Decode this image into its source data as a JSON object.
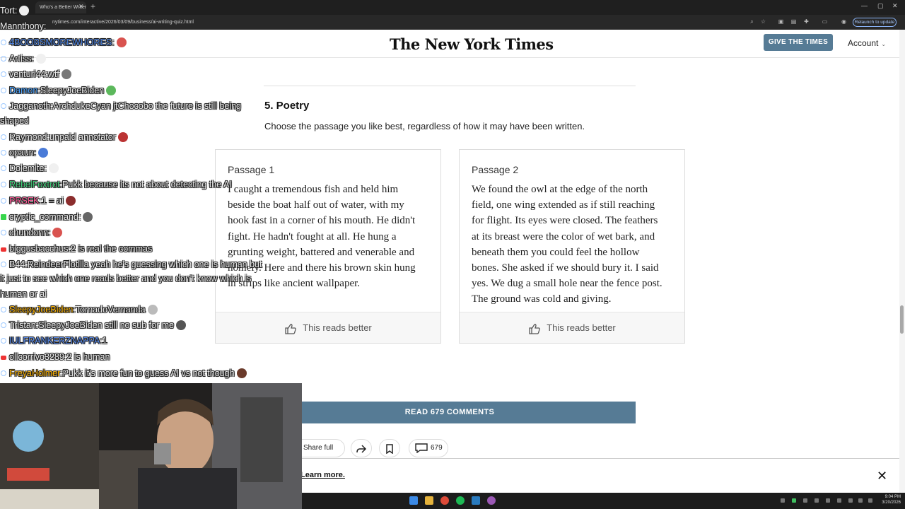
{
  "browser": {
    "tab_title": "Who's a Better Writer: A.I. or H",
    "url": "nytimes.com/interactive/2026/03/09/business/ai-writing-quiz.html",
    "update_label": "Relaunch to update"
  },
  "nyt": {
    "logo": "The New York Times",
    "give_button": "GIVE THE TIMES",
    "account": "Account"
  },
  "quiz": {
    "section_title": "5. Poetry",
    "instructions": "Choose the passage you like best, regardless of how it may have been written.",
    "passages": [
      {
        "label": "Passage 1",
        "text": "I caught a tremendous fish and held him beside the boat half out of water, with my hook fast in a corner of his mouth. He didn't fight. He hadn't fought at all. He hung a grunting weight, battered and venerable and homely. Here and there his brown skin hung in strips like ancient wallpaper.",
        "vote_label": "This reads better"
      },
      {
        "label": "Passage 2",
        "text": "We found the owl at the edge of the north field, one wing extended as if still reaching for flight. Its eyes were closed. The feathers at its breast were the color of wet bark, and beneath them you could feel the hollow bones. She asked if we should bury it. I said yes. We dug a small hole near the fence post. The ground was cold and giving.",
        "vote_label": "This reads better"
      }
    ],
    "comments_button": "READ 679 COMMENTS",
    "share_label": "Share full article",
    "comment_count": "679"
  },
  "banner": {
    "link_text": "Learn more."
  },
  "taskbar": {
    "time": "9:04 PM",
    "date": "3/20/2026"
  },
  "chat": {
    "lines": [
      {
        "user": "Tort",
        "msg": "",
        "color": "#eaeaea",
        "badge": "none",
        "emote": "#f0f0f0"
      },
      {
        "user": "Mannthony",
        "msg": "",
        "color": "#eaeaea",
        "badge": "none",
        "emote": ""
      },
      {
        "user": "4BOOBSMOREWHORES",
        "msg": "",
        "color": "#4d86e8",
        "badge": "circle",
        "emote": "#d9534f"
      },
      {
        "user": "Artiss",
        "msg": "",
        "color": "#eaeaea",
        "badge": "circle",
        "emote": "#f0f0f0"
      },
      {
        "user": "venturi44",
        "msg": "wtf",
        "color": "#eaeaea",
        "badge": "circle",
        "emote": "#777"
      },
      {
        "user": "Damon",
        "msg": "SleepyJoeBiden",
        "color": "#4aa3ff",
        "badge": "circle",
        "emote": "#5cb85c"
      },
      {
        "user": "Jagganoth",
        "msg": "ArchdukeCyan jtChocobo the future is still being",
        "color": "#eaeaea",
        "badge": "circle",
        "emote": ""
      },
      {
        "user": "Raymond",
        "msg": "unpaid annotator",
        "color": "#eaeaea",
        "badge": "circle",
        "emote": "#b33"
      },
      {
        "user": "opaun",
        "msg": "",
        "color": "#eaeaea",
        "badge": "circle",
        "emote": "#4a7bd8"
      },
      {
        "user": "Dolemite",
        "msg": "",
        "color": "#eaeaea",
        "badge": "circle",
        "emote": "#f0f0f0"
      },
      {
        "user": "RebelFoxtrot",
        "msg": "Pukk because its not about detecting the AI",
        "color": "#3fd07a",
        "badge": "circle",
        "emote": ""
      },
      {
        "user": "PRSEK",
        "msg": "1 = ai",
        "color": "#ff5e9a",
        "badge": "circle",
        "emote": "#8b2d2d"
      },
      {
        "user": "cryptic_command",
        "msg": "",
        "color": "#eaeaea",
        "badge": "green",
        "emote": "#666"
      },
      {
        "user": "chundonn",
        "msg": "",
        "color": "#eaeaea",
        "badge": "circle",
        "emote": "#d9534f"
      },
      {
        "user": "biggusbacchus",
        "msg": "2 is real the commas",
        "color": "#eaeaea",
        "badge": "red",
        "emote": ""
      },
      {
        "user": "B44",
        "msg": "ReindeerFlotilla yeah he's guessing which one is human but",
        "color": "#eaeaea",
        "badge": "circle",
        "emote": ""
      },
      {
        "user": "SleepyJoeBiden",
        "msg": "TornadoVernanda",
        "color": "#ffb400",
        "badge": "circle",
        "emote": "#bbb"
      },
      {
        "user": "Tristan",
        "msg": "SleepyJoeBiden still no sub for me",
        "color": "#eaeaea",
        "badge": "circle",
        "emote": "#555"
      },
      {
        "user": "IULFRANKERZNAPPA",
        "msg": "1",
        "color": "#5b8ef0",
        "badge": "circle",
        "emote": ""
      },
      {
        "user": "ollcorrivo3289",
        "msg": "2 is human",
        "color": "#eaeaea",
        "badge": "red",
        "emote": ""
      },
      {
        "user": "FreyaHolmer",
        "msg": "Pukk it's more fun to guess AI vs not though",
        "color": "#ffb400",
        "badge": "circle",
        "emote": "#6b3b2b"
      }
    ],
    "wrap_jagganoth": "shaped",
    "wrap_b44_1": "it just to see which one reads better and you don't know which is",
    "wrap_b44_2": "human or ai"
  }
}
